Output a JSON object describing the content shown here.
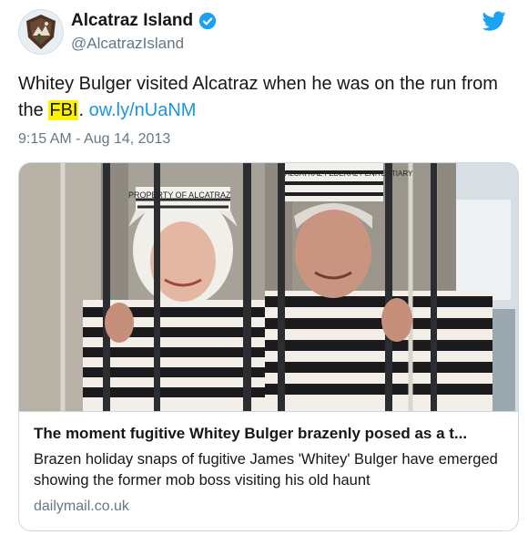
{
  "account": {
    "display_name": "Alcatraz Island",
    "handle": "@AlcatrazIsland",
    "avatar_icon": "nps-arrowhead-icon",
    "verified_icon": "verified-badge-icon"
  },
  "tweet": {
    "text_before": "Whitey Bulger visited Alcatraz when he was on the run from the ",
    "highlight": "FBI",
    "text_after": ". ",
    "link": "ow.ly/nUaNM",
    "timestamp": "9:15 AM - Aug 14, 2013"
  },
  "brand": {
    "logo_icon": "twitter-bird-icon",
    "accent": "#1da1f2",
    "link_color": "#1b95e0",
    "highlight_color": "#fff200"
  },
  "card": {
    "photo_caps": {
      "left": "PROPERTY OF ALCATRAZ",
      "right": "ALCATRAZ FEDERAL PENITENTIARY"
    },
    "title": "The moment fugitive Whitey Bulger brazenly posed as a t...",
    "description": "Brazen holiday snaps of fugitive James 'Whitey' Bulger have emerged showing the former mob boss visiting his old haunt",
    "domain": "dailymail.co.uk"
  }
}
